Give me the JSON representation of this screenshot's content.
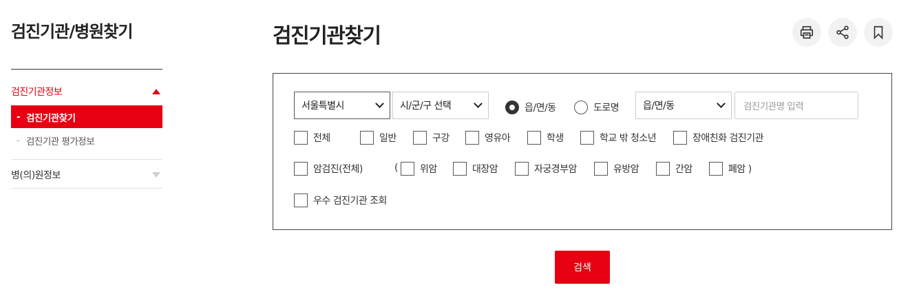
{
  "sidebar": {
    "title": "검진기관/병원찾기",
    "groups": [
      {
        "label": "검진기관정보",
        "items": [
          {
            "label": "검진기관찾기"
          },
          {
            "label": "검진기관 평가정보"
          }
        ]
      },
      {
        "label": "병(의)원정보"
      }
    ],
    "item_dash": "-"
  },
  "main": {
    "title": "검진기관찾기",
    "tools": [
      {
        "icon": "print-icon"
      },
      {
        "icon": "share-icon"
      },
      {
        "icon": "bookmark-icon"
      }
    ]
  },
  "search": {
    "city_select": "서울특별시",
    "district_select": "시/군/구 선택",
    "radio_options": [
      {
        "label": "읍/면/동",
        "checked": true
      },
      {
        "label": "도로명",
        "checked": false
      }
    ],
    "town_select": "읍/면/동",
    "name_placeholder": "검진기관명 입력",
    "type_checkboxes": [
      "전체",
      "일반",
      "구강",
      "영유아",
      "학생",
      "학교 밖 청소년",
      "장애친화 검진기관"
    ],
    "cancer_all": "암검진(전체)",
    "paren_open": "(",
    "cancer_checkboxes": [
      "위암",
      "대장암",
      "자궁경부암",
      "유방암",
      "간암",
      "폐암 )"
    ],
    "excellent": "우수 검진기관 조회",
    "submit_label": "검색"
  },
  "colors": {
    "accent": "#e60012"
  }
}
